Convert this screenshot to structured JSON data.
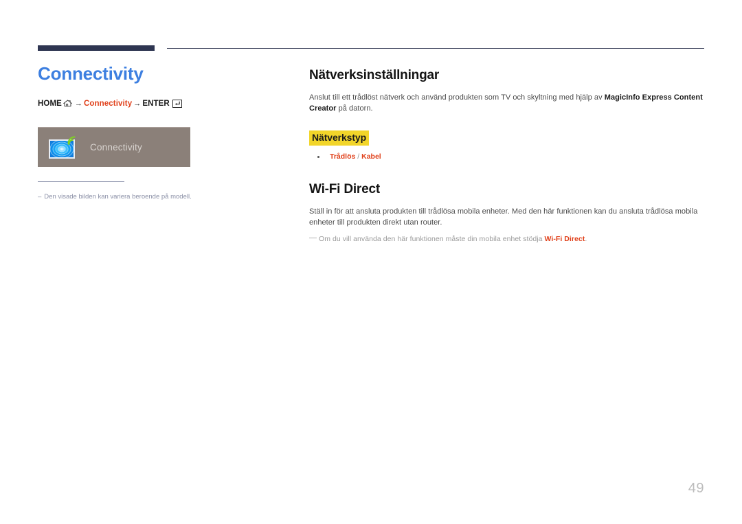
{
  "page": {
    "number": "49",
    "accent_blue": "#3d7fe0",
    "accent_red": "#e0401a",
    "highlight_yellow": "#f2d52a",
    "rule_navy": "#2e3551",
    "menu_box_bg": "#8b8079"
  },
  "left": {
    "chapter_title": "Connectivity",
    "breadcrumb": {
      "home_label": "HOME",
      "home_icon": "home-icon",
      "arrow_1": "→",
      "middle_label": "Connectivity",
      "arrow_2": "→",
      "enter_label": "ENTER",
      "enter_icon": "enter-key-icon"
    },
    "menu_box": {
      "icon": "connectivity-display-wifi-icon",
      "label": "Connectivity"
    },
    "note": {
      "dash": "–",
      "text": "Den visade bilden kan variera beroende på modell."
    }
  },
  "right": {
    "section_1": {
      "title": "Nätverksinställningar",
      "body_before_bold": "Anslut till ett trådlöst nätverk och använd produkten som TV och skyltning med hjälp av ",
      "body_bold": "MagicInfo Express Content Creator",
      "body_after_bold": " på datorn.",
      "highlight_heading": "Nätverkstyp",
      "bullet_1_a": "Trådlös",
      "bullet_1_sep": " / ",
      "bullet_1_b": "Kabel"
    },
    "section_2": {
      "title": "Wi-Fi Direct",
      "body": "Ställ in för att ansluta produkten till trådlösa mobila enheter. Med den här funktionen kan du ansluta trådlösa mobila enheter till produkten direkt utan router.",
      "note_before_bold": "Om du vill använda den här funktionen måste din mobila enhet stödja ",
      "note_bold": "Wi-Fi Direct",
      "note_after_bold": "."
    }
  }
}
